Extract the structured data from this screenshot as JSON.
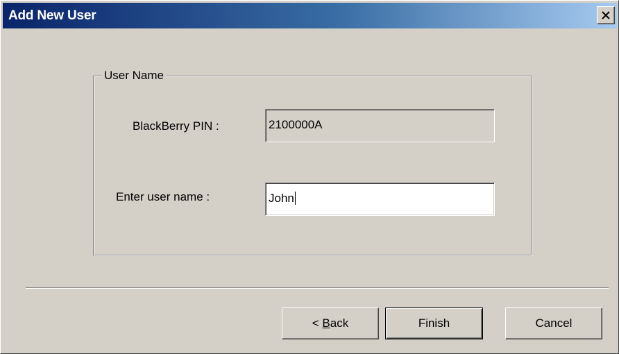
{
  "window": {
    "title": "Add New User",
    "close_glyph": "close-icon"
  },
  "group": {
    "label": "User Name"
  },
  "fields": {
    "pin_label": "BlackBerry PIN :",
    "pin_value": "2100000A",
    "name_label": "Enter user name :",
    "name_value": "John"
  },
  "buttons": {
    "back_prefix": "< ",
    "back_mnemonic": "B",
    "back_suffix": "ack",
    "finish": "Finish",
    "cancel": "Cancel"
  },
  "colors": {
    "face": "#d4d0c8",
    "title_start": "#0a246a",
    "title_end": "#a6caf0"
  }
}
